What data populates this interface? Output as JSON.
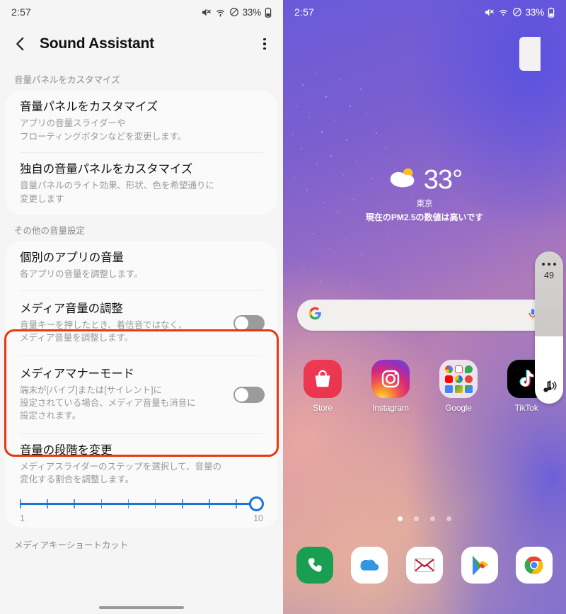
{
  "left_screen": {
    "status_bar": {
      "time": "2:57",
      "battery_percent": "33%",
      "icons": [
        "mute-icon",
        "wifi-icon",
        "do-not-disturb-icon",
        "battery-icon"
      ]
    },
    "header": {
      "back": "back-icon",
      "title": "Sound Assistant",
      "overflow": "more-options-icon"
    },
    "sections": [
      {
        "label": "音量パネルをカスタマイズ",
        "rows": [
          {
            "title": "音量パネルをカスタマイズ",
            "subtitle": "アプリの音量スライダーや\nフローティングボタンなどを変更します。",
            "toggle": null
          },
          {
            "title": "独自の音量パネルをカスタマイズ",
            "subtitle": "音量パネルのライト効果、形状、色を希望通りに\n変更します",
            "toggle": null
          }
        ]
      },
      {
        "label": "その他の音量設定",
        "rows": [
          {
            "title": "個別のアプリの音量",
            "subtitle": "各アプリの音量を調整します。",
            "toggle": null
          },
          {
            "title": "メディア音量の調整",
            "subtitle": "音量キーを押したとき、着信音ではなく、\nメディア音量を調整します。",
            "toggle": "off"
          },
          {
            "title": "メディアマナーモード",
            "subtitle": "端末が[バイブ]または[サイレント]に\n設定されている場合、メディア音量も消音に\n設定されます。",
            "toggle": "off"
          },
          {
            "title": "音量の段階を変更",
            "subtitle": "メディアスライダーのステップを選択して、音量の\n変化する割合を調整します。",
            "toggle": null
          }
        ]
      }
    ],
    "slider": {
      "min_label": "1",
      "max_label": "10",
      "value": 10,
      "min": 1,
      "max": 10,
      "accent_color": "#1a73d8"
    },
    "bottom_section_label": "メディアキーショートカット",
    "highlight_color": "#e8380d"
  },
  "right_screen": {
    "status_bar": {
      "time": "2:57",
      "battery_percent": "33%",
      "icons": [
        "mute-icon",
        "wifi-icon",
        "do-not-disturb-icon",
        "battery-icon"
      ]
    },
    "weather": {
      "temperature": "33°",
      "city": "東京",
      "note": "現在のPM2.5の数値は高いです",
      "condition_icon": "partly-cloudy-icon"
    },
    "search": {
      "placeholder": "",
      "value": "",
      "left_icon": "google-logo-icon",
      "right_icon": "microphone-icon"
    },
    "apps": [
      {
        "label": "Store",
        "icon": "galaxy-store-icon"
      },
      {
        "label": "Instagram",
        "icon": "instagram-icon"
      },
      {
        "label": "Google",
        "icon": "google-folder-icon"
      },
      {
        "label": "TikTok",
        "icon": "tiktok-icon"
      }
    ],
    "page_dots": {
      "count": 4,
      "active_index": 0
    },
    "dock": [
      {
        "icon": "phone-icon"
      },
      {
        "icon": "onedrive-icon"
      },
      {
        "icon": "mail-icon"
      },
      {
        "icon": "play-store-icon"
      },
      {
        "icon": "chrome-icon"
      }
    ],
    "volume_panel": {
      "value": "49",
      "menu_icon": "more-options-icon",
      "sound_icon": "media-volume-icon"
    }
  }
}
